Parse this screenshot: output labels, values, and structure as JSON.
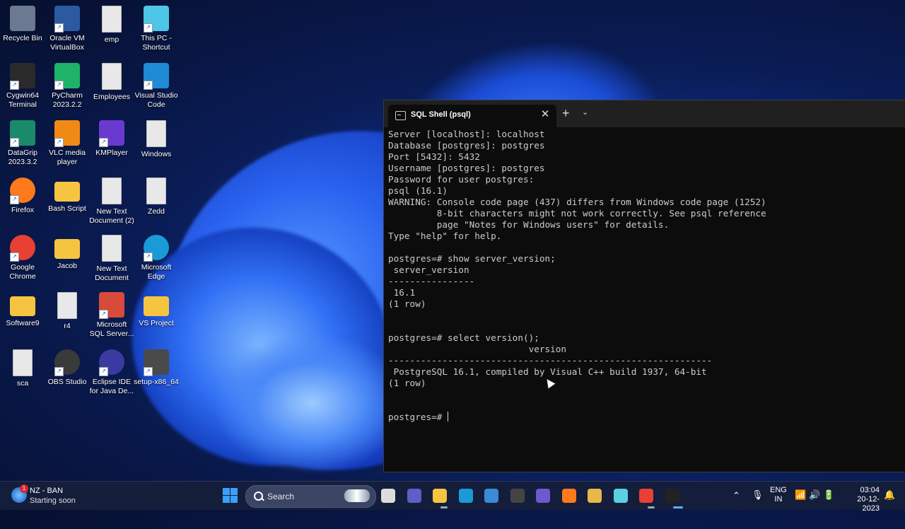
{
  "desktop_icons": [
    {
      "label": "Recycle Bin",
      "icon": "recycle-bin-icon"
    },
    {
      "label": "Oracle VM VirtualBox",
      "icon": "virtualbox-icon"
    },
    {
      "label": "emp",
      "icon": "file-icon"
    },
    {
      "label": "This PC - Shortcut",
      "icon": "monitor-icon"
    },
    {
      "label": "Cygwin64 Terminal",
      "icon": "terminal-icon"
    },
    {
      "label": "PyCharm 2023.2.2",
      "icon": "pycharm-icon"
    },
    {
      "label": "Employees",
      "icon": "file-icon"
    },
    {
      "label": "Visual Studio Code",
      "icon": "vscode-icon"
    },
    {
      "label": "DataGrip 2023.3.2",
      "icon": "datagrip-icon"
    },
    {
      "label": "VLC media player",
      "icon": "vlc-icon"
    },
    {
      "label": "KMPlayer",
      "icon": "kmplayer-icon"
    },
    {
      "label": "Windows",
      "icon": "file-icon"
    },
    {
      "label": "Firefox",
      "icon": "firefox-icon"
    },
    {
      "label": "Bash Script",
      "icon": "folder-icon"
    },
    {
      "label": "New Text Document (2)",
      "icon": "file-icon"
    },
    {
      "label": "Zedd",
      "icon": "file-icon"
    },
    {
      "label": "Google Chrome",
      "icon": "chrome-icon"
    },
    {
      "label": "Jacob",
      "icon": "folder-icon"
    },
    {
      "label": "New Text Document",
      "icon": "file-icon"
    },
    {
      "label": "Microsoft Edge",
      "icon": "edge-icon"
    },
    {
      "label": "Software9",
      "icon": "folder-icon"
    },
    {
      "label": "r4",
      "icon": "file-icon"
    },
    {
      "label": "Microsoft SQL Server...",
      "icon": "sqlserver-icon"
    },
    {
      "label": "VS Project",
      "icon": "folder-icon"
    },
    {
      "label": "sca",
      "icon": "file-icon"
    },
    {
      "label": "OBS Studio",
      "icon": "obs-icon"
    },
    {
      "label": "Eclipse IDE for Java De...",
      "icon": "eclipse-icon"
    },
    {
      "label": "setup-x86_64",
      "icon": "installer-icon"
    }
  ],
  "terminal": {
    "tab_title": "SQL Shell (psql)",
    "close_glyph": "✕",
    "new_tab_glyph": "+",
    "dropdown_glyph": "⌄",
    "lines": [
      "Server [localhost]: localhost",
      "Database [postgres]: postgres",
      "Port [5432]: 5432",
      "Username [postgres]: postgres",
      "Password for user postgres:",
      "psql (16.1)",
      "WARNING: Console code page (437) differs from Windows code page (1252)",
      "         8-bit characters might not work correctly. See psql reference",
      "         page \"Notes for Windows users\" for details.",
      "Type \"help\" for help.",
      "",
      "postgres=# show server_version;",
      " server_version",
      "----------------",
      " 16.1",
      "(1 row)",
      "",
      "",
      "postgres=# select version();",
      "                          version",
      "------------------------------------------------------------",
      " PostgreSQL 16.1, compiled by Visual C++ build 1937, 64-bit",
      "(1 row)",
      "",
      "",
      "postgres=# "
    ]
  },
  "taskbar": {
    "weather": {
      "badge": "1",
      "line1": "NZ - BAN",
      "line2": "Starting soon"
    },
    "search_label": "Search",
    "apps": [
      "task-view-icon",
      "teams-icon",
      "file-explorer-icon",
      "edge-icon",
      "store-icon",
      "app-icon",
      "vs-icon",
      "firefox-icon",
      "sticky-icon",
      "notepad-icon",
      "chrome-icon",
      "terminal-icon"
    ],
    "lang_line1": "ENG",
    "lang_line2": "IN",
    "time": "03:04",
    "date": "20-12-2023"
  }
}
